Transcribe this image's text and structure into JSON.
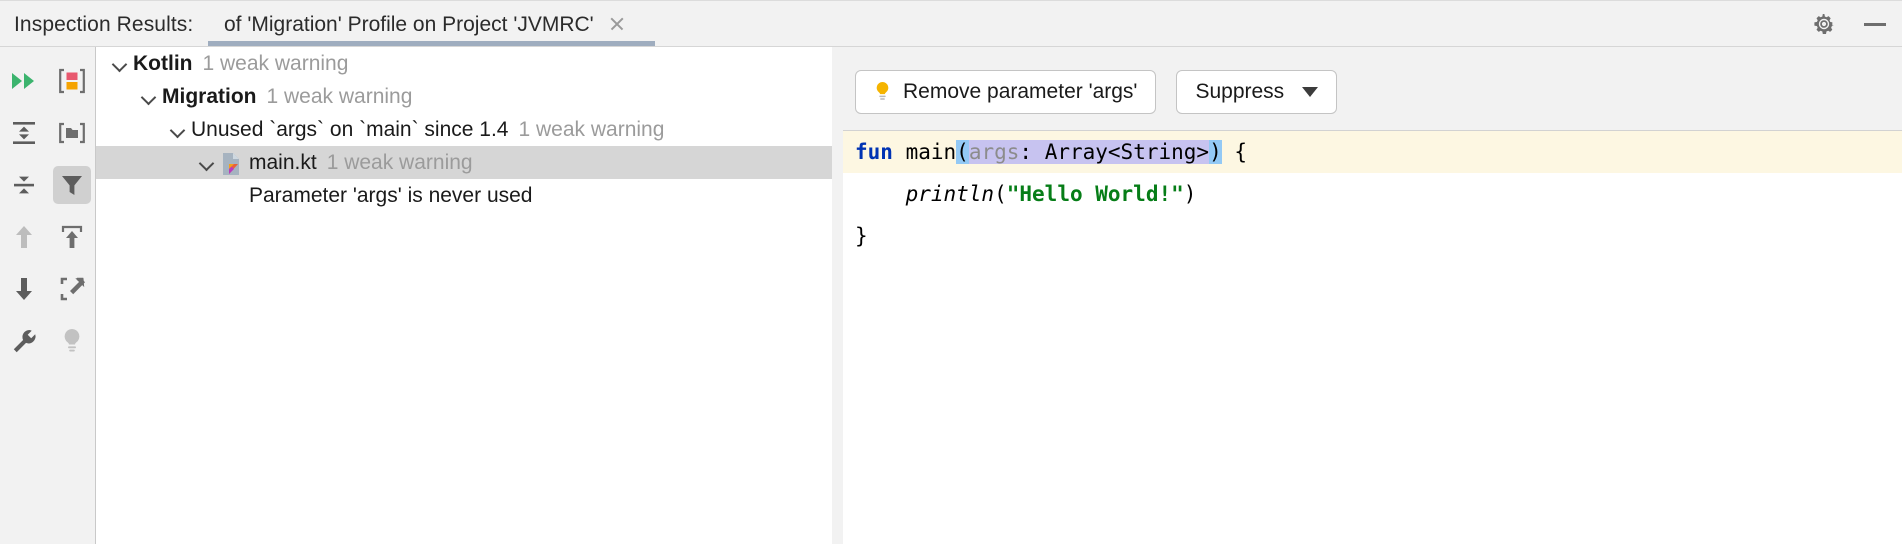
{
  "header": {
    "title": "Inspection Results:",
    "tab_label": "of 'Migration' Profile on Project 'JVMRC'",
    "close_icon": "close-icon",
    "settings_icon": "gear-icon",
    "minimize_icon": "minimize-icon"
  },
  "toolbar": {
    "items": [
      {
        "name": "rerun-inspection",
        "icon": "double-play-icon"
      },
      {
        "name": "group-by-severity",
        "icon": "severity-brackets-icon"
      },
      {
        "name": "expand-all",
        "icon": "expand-all-icon"
      },
      {
        "name": "group-by-directory",
        "icon": "folder-brackets-icon"
      },
      {
        "name": "collapse-all",
        "icon": "collapse-all-icon"
      },
      {
        "name": "filter-results",
        "icon": "funnel-icon",
        "active": true
      },
      {
        "name": "previous-problem",
        "icon": "arrow-up-icon",
        "disabled": true
      },
      {
        "name": "export-results",
        "icon": "export-arrow-up-icon"
      },
      {
        "name": "next-problem",
        "icon": "arrow-down-icon"
      },
      {
        "name": "open-in-editor",
        "icon": "open-external-icon"
      },
      {
        "name": "edit-settings",
        "icon": "wrench-icon"
      },
      {
        "name": "show-quick-fixes",
        "icon": "lightbulb-gray-icon"
      }
    ]
  },
  "tree": {
    "rows": [
      {
        "label": "Kotlin",
        "count": "1 weak warning",
        "indent": 0,
        "bold": true,
        "expanded": true,
        "icon": null,
        "selected": false
      },
      {
        "label": "Migration",
        "count": "1 weak warning",
        "indent": 1,
        "bold": true,
        "expanded": true,
        "icon": null,
        "selected": false
      },
      {
        "label": "Unused `args` on `main` since 1.4",
        "count": "1 weak warning",
        "indent": 2,
        "bold": false,
        "expanded": true,
        "icon": null,
        "selected": false
      },
      {
        "label": "main.kt",
        "count": "1 weak warning",
        "indent": 3,
        "bold": false,
        "expanded": true,
        "icon": "kotlin-file-icon",
        "selected": true
      },
      {
        "label": "Parameter 'args' is never used",
        "count": "",
        "indent": 4,
        "bold": false,
        "expanded": false,
        "icon": null,
        "selected": false
      }
    ]
  },
  "right": {
    "fix_button": "Remove parameter 'args'",
    "fix_button_icon": "lightbulb-icon",
    "suppress_button": "Suppress",
    "suppress_caret": "chevron-down-icon",
    "code": {
      "line1": {
        "kw": "fun",
        "space1": " ",
        "name": "main",
        "open_paren": "(",
        "param_name": "args",
        "param_rest": ": Array<String>",
        "close_paren": ")",
        "tail": " {"
      },
      "line2_indent": "    ",
      "line2_call": "println",
      "line2_open": "(",
      "line2_str": "\"Hello World!\"",
      "line2_close": ")",
      "line3": "}"
    }
  },
  "colors": {
    "accent_tab_underline": "#9fadbf",
    "selection_row": "#d6d6d6",
    "code_highlight_line": "#fdf7e2",
    "param_selection": "#c7c3f0",
    "paren_match": "#93c9f5",
    "keyword": "#0033b3",
    "string": "#067d17",
    "bulb_yellow": "#f5b400",
    "run_green": "#3cb46e"
  }
}
